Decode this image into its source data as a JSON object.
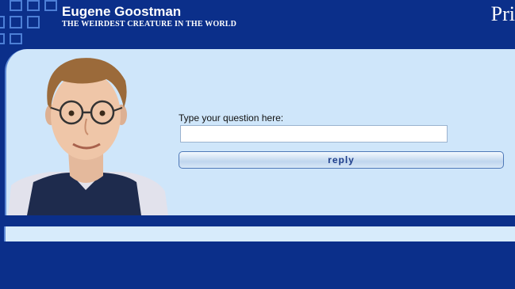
{
  "header": {
    "title": "Eugene Goostman",
    "subtitle": "THE WEIRDEST CREATURE IN THE WORLD",
    "corner_text": "Pri",
    "logo_icon": "blue-squares-grid-icon"
  },
  "chat": {
    "prompt_label": "Type your question here:",
    "input_value": "",
    "input_placeholder": "",
    "reply_label": "reply",
    "avatar": "boy-with-glasses-avatar"
  },
  "colors": {
    "header_bg": "#0b2f8a",
    "panel_bg": "#cfe6fa",
    "button_text": "#1d3d8a"
  }
}
